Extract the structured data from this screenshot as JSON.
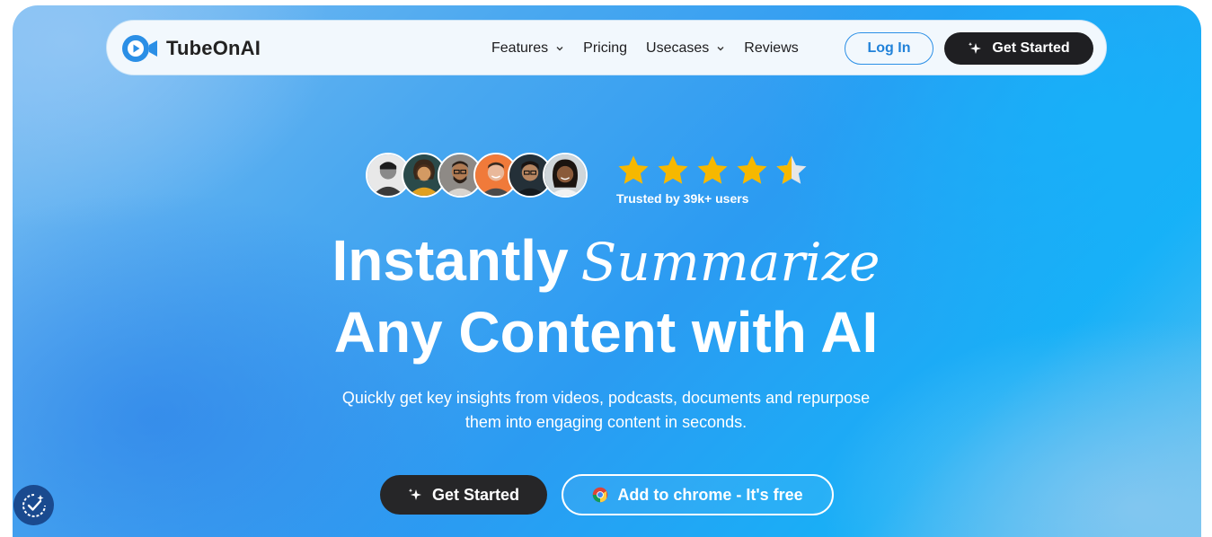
{
  "nav": {
    "brand": "TubeOnAI",
    "links": [
      {
        "label": "Features",
        "has_dropdown": true
      },
      {
        "label": "Pricing",
        "has_dropdown": false
      },
      {
        "label": "Usecases",
        "has_dropdown": true
      },
      {
        "label": "Reviews",
        "has_dropdown": false
      }
    ],
    "login_label": "Log In",
    "get_started_label": "Get Started"
  },
  "social_proof": {
    "rating_stars": 4.5,
    "trusted_text": "Trusted by 39k+ users"
  },
  "hero": {
    "headline_line1": "Instantly",
    "headline_accent": "Summarize",
    "headline_line2": "Any Content with AI",
    "subtitle_line1": "Quickly get key insights from videos, podcasts, documents and repurpose",
    "subtitle_line2": "them into engaging content in seconds.",
    "cta_primary": "Get Started",
    "cta_secondary": "Add to chrome - It's free"
  },
  "colors": {
    "brand_blue": "#2b8fe6",
    "dark_button": "#1f1f22",
    "star_gold": "#f6b800"
  },
  "icons": {
    "logo": "video-camera-icon",
    "sparkle": "sparkle-icon",
    "chrome": "chrome-icon",
    "cookie": "cookie-consent-icon"
  }
}
